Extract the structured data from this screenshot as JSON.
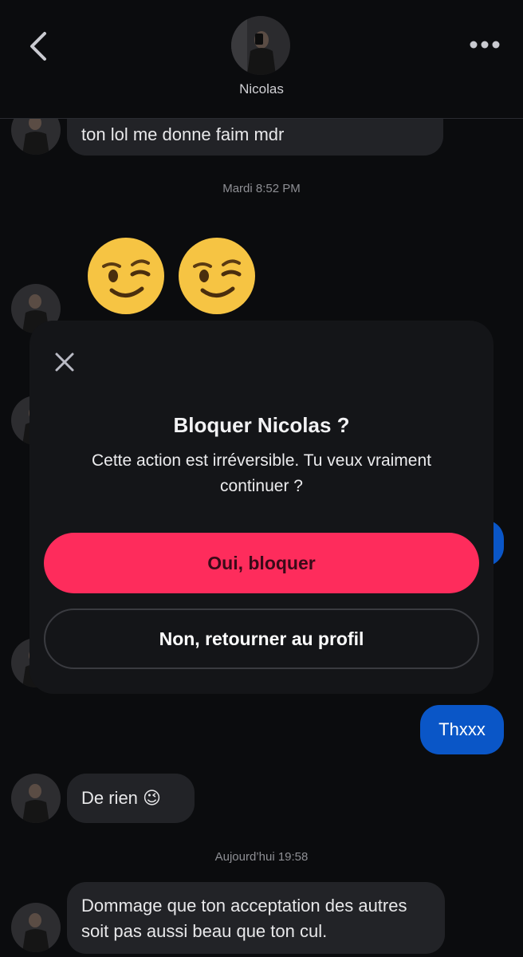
{
  "header": {
    "contact_name": "Nicolas",
    "icons": {
      "back": "chevron-left-icon",
      "more": "more-dots-icon"
    }
  },
  "messages": [
    {
      "type": "received",
      "text": "ton lol me donne faim mdr"
    },
    {
      "type": "timestamp",
      "text": "Mardi 8:52 PM"
    },
    {
      "type": "received-emoji",
      "emoji": "winking-face x2"
    },
    {
      "type": "sent",
      "text": "Thxxx"
    },
    {
      "type": "received",
      "text": "De rien 😉"
    },
    {
      "type": "timestamp",
      "text": "Aujourd’hui 19:58"
    },
    {
      "type": "received",
      "text": "Dommage que ton acceptation des autres soit pas aussi beau que ton cul."
    }
  ],
  "dialog": {
    "title": "Bloquer Nicolas ?",
    "message": "Cette action est irréversible. Tu veux vraiment continuer ?",
    "confirm_label": "Oui, bloquer",
    "cancel_label": "Non, retourner au profil",
    "close_icon": "close-icon"
  },
  "colors": {
    "background": "#0b0c0e",
    "received_bubble": "#222327",
    "sent_bubble": "#0a56c7",
    "danger": "#fe2c5c",
    "dialog": "#141518"
  }
}
